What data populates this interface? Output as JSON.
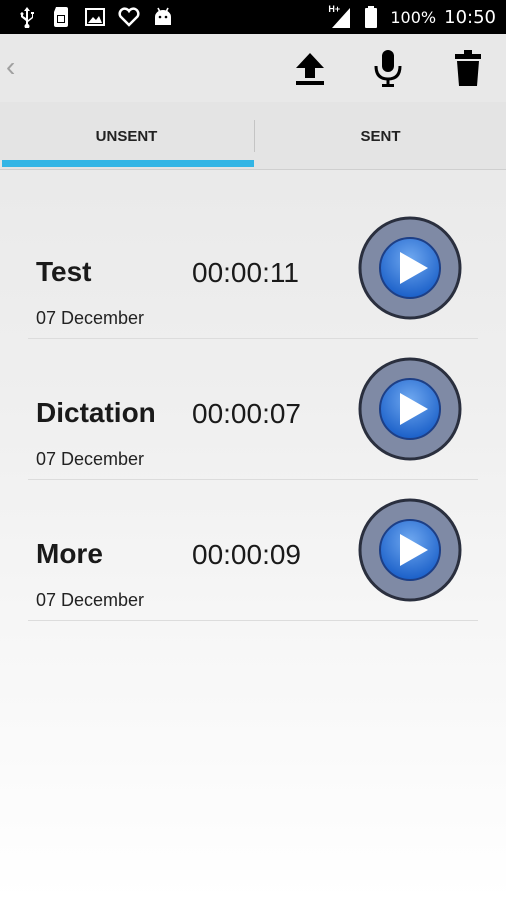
{
  "status_bar": {
    "left_icons": [
      "usb-icon",
      "sim-icon",
      "image-icon",
      "heart-icon",
      "android-icon"
    ],
    "network_label": "H+",
    "battery": "100%",
    "time": "10:50"
  },
  "action_bar": {
    "back_glyph": "‹",
    "actions": [
      "upload-icon",
      "microphone-icon",
      "trash-icon"
    ]
  },
  "tabs": [
    {
      "label": "UNSENT",
      "active": true
    },
    {
      "label": "SENT",
      "active": false
    }
  ],
  "accent_color": "#33b5e5",
  "recordings": [
    {
      "name": "Test",
      "duration": "00:00:11",
      "date": "07 December"
    },
    {
      "name": "Dictation",
      "duration": "00:00:07",
      "date": "07 December"
    },
    {
      "name": "More",
      "duration": "00:00:09",
      "date": "07 December"
    }
  ]
}
